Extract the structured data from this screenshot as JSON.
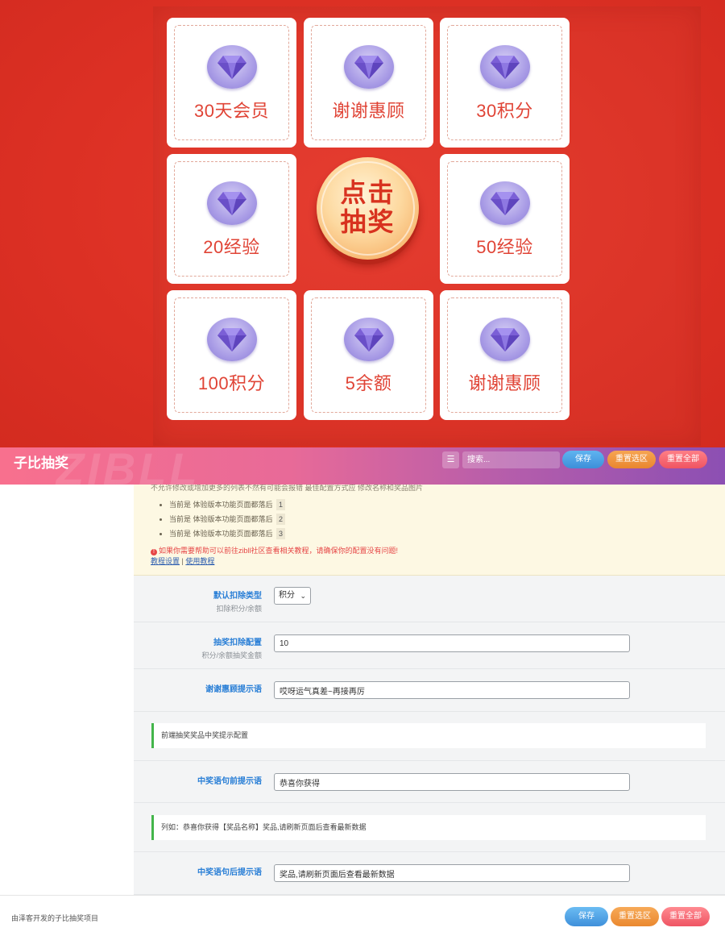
{
  "board": {
    "prizes": [
      {
        "label": "30天会员"
      },
      {
        "label": "谢谢惠顾"
      },
      {
        "label": "30积分"
      },
      {
        "label": "20经验"
      },
      {
        "label": "50经验"
      },
      {
        "label": "100积分"
      },
      {
        "label": "5余额"
      },
      {
        "label": "谢谢惠顾"
      }
    ],
    "draw_button": {
      "line1": "点击",
      "line2": "抽奖"
    },
    "gem_icon": "diamond-icon",
    "accent_color": "#dc3024"
  },
  "header": {
    "title": "子比抽奖",
    "watermark": "ZIBLL",
    "search_placeholder": "搜索...",
    "save_label": "保存",
    "reset_section_label": "重置选区",
    "reset_all_label": "重置全部"
  },
  "notice": {
    "cut_text": "不允许修改或增加更多的列表不然有可能会报错 最佳配置方式应 修改名称和奖品图片",
    "items": [
      {
        "text": "当前是 体验版本功能页面都落后",
        "num": "1"
      },
      {
        "text": "当前是 体验版本功能页面都落后",
        "num": "2"
      },
      {
        "text": "当前是 体验版本功能页面都落后",
        "num": "3"
      }
    ],
    "warning": "如果你需要帮助可以前往zibll社区查看相关教程，请确保你的配置没有问题!",
    "link1": "教程设置",
    "separator": "|",
    "link2": "使用教程"
  },
  "fields": {
    "deduct_type": {
      "label": "默认扣除类型",
      "desc": "扣除积分/余额",
      "value": "积分"
    },
    "deduct_amount": {
      "label": "抽奖扣除配置",
      "desc": "积分/余额抽奖金额",
      "value": "10"
    },
    "thanks_tip": {
      "label": "谢谢惠顾提示语",
      "value": "哎呀运气真差~再接再厉"
    },
    "section_title": "前端抽奖奖品中奖提示配置",
    "win_prefix": {
      "label": "中奖语句前提示语",
      "value": "恭喜你获得"
    },
    "example": "列如：恭喜你获得【奖品名称】奖品,请刷新页面后查看最新数据",
    "win_suffix": {
      "label": "中奖语句后提示语",
      "value": "奖品,请刷新页面后查看最新数据"
    }
  },
  "footer": {
    "credit": "由泽客开发的子比抽奖项目",
    "save_label": "保存",
    "reset_section_label": "重置选区",
    "reset_all_label": "重置全部"
  }
}
